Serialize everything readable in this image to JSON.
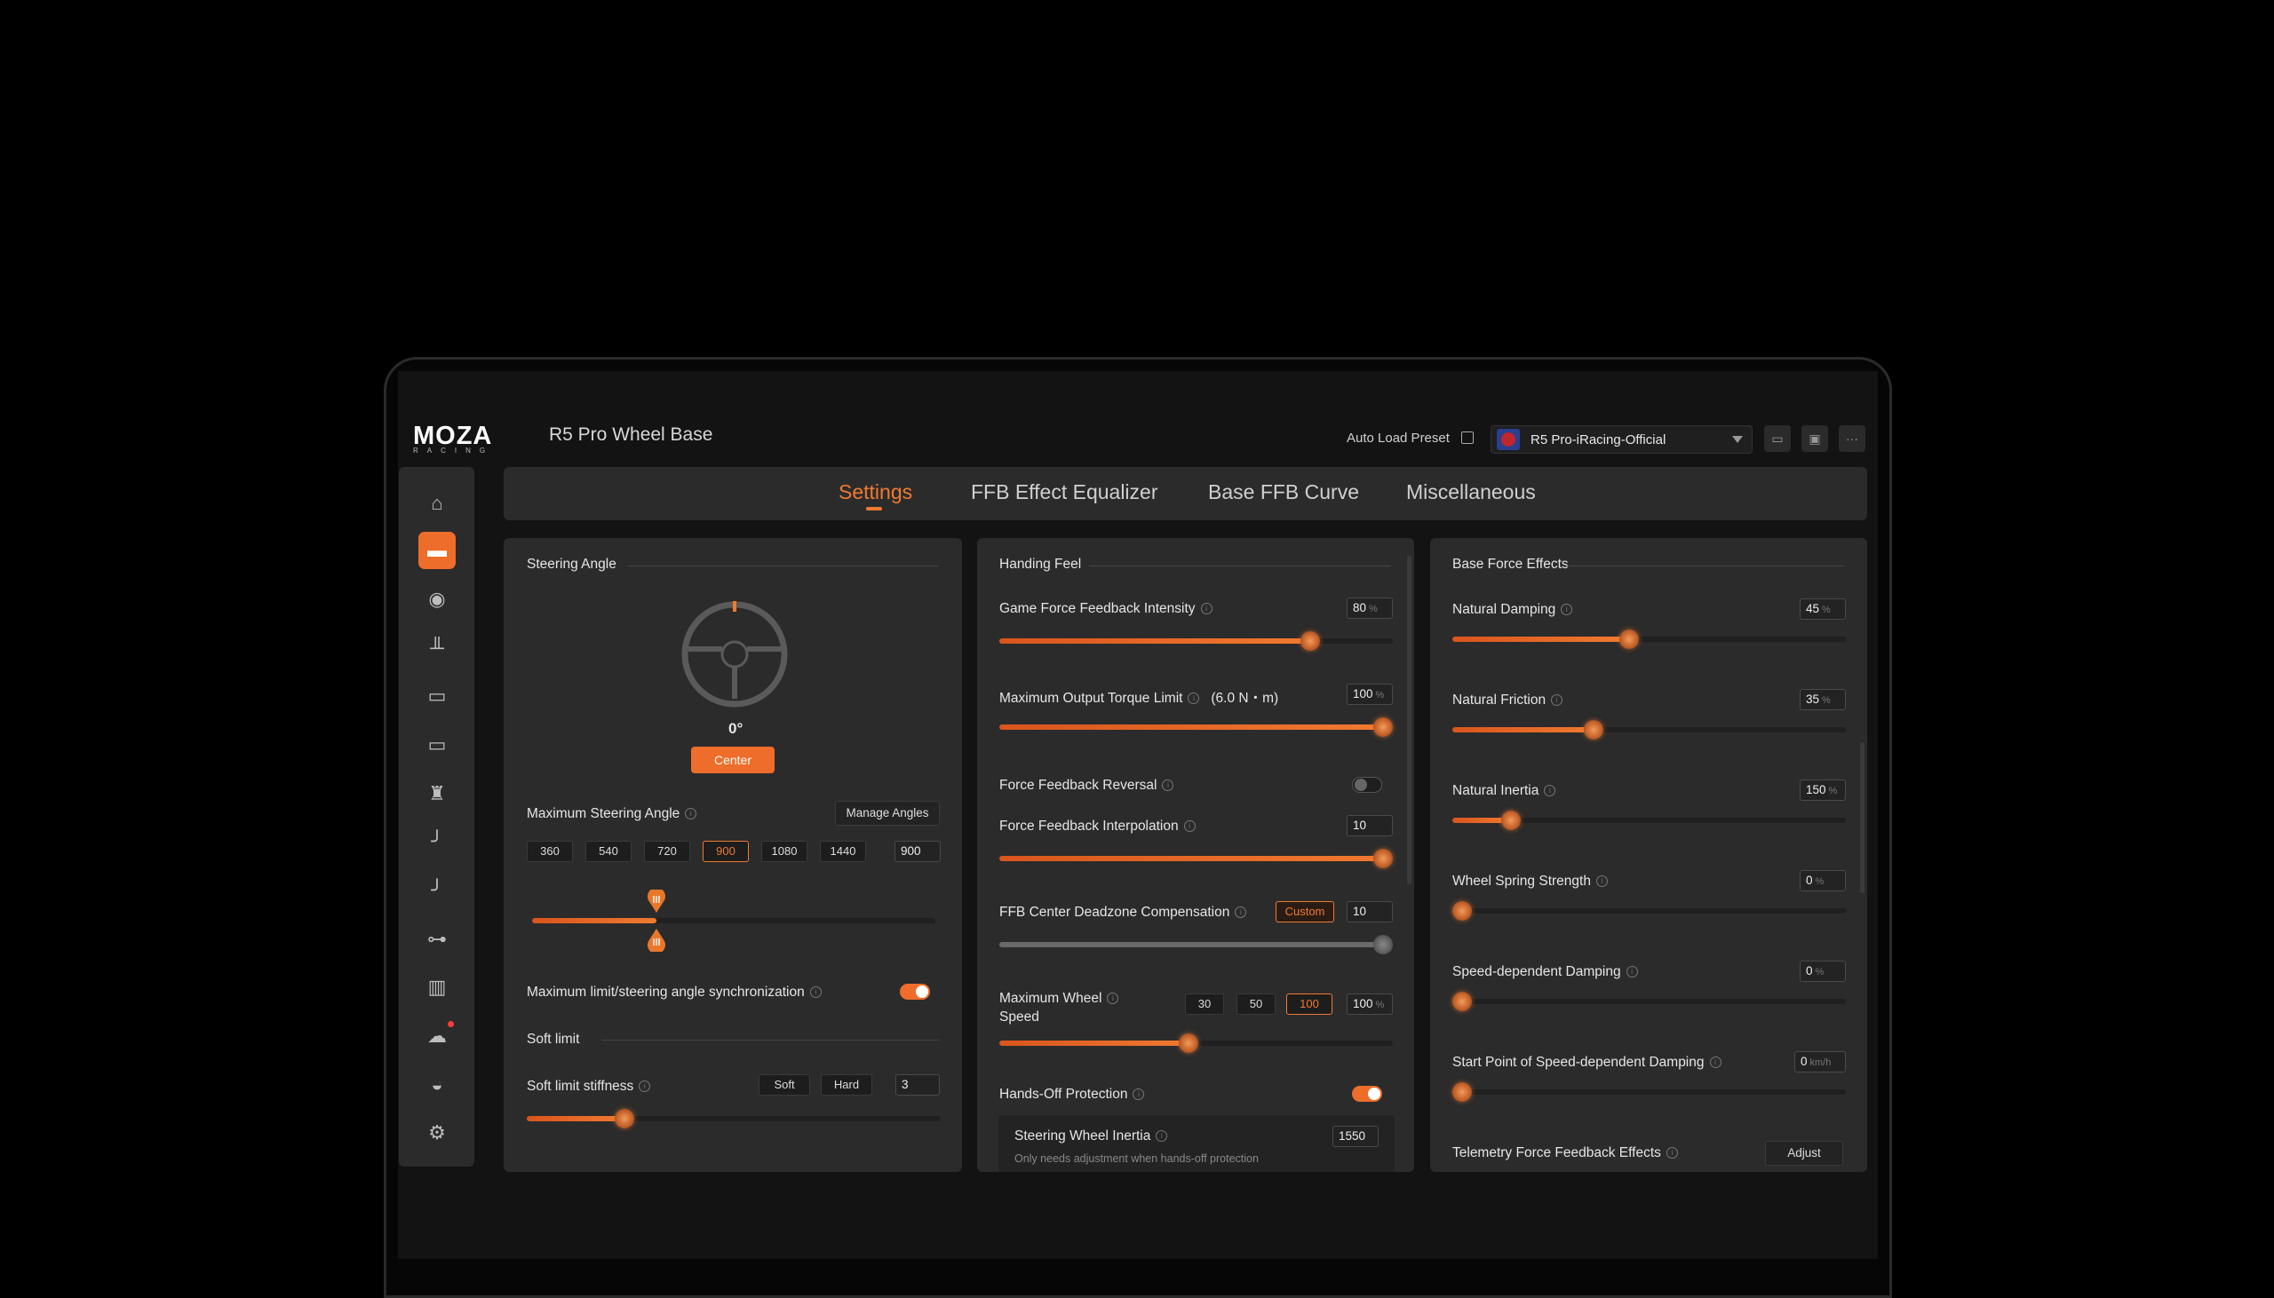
{
  "app": {
    "logo": "MOZA",
    "logo_sub": "RACING",
    "title": "R5 Pro Wheel Base"
  },
  "topbar": {
    "auto_load_label": "Auto Load Preset",
    "preset_name": "R5 Pro-iRacing-Official",
    "more_glyph": "···"
  },
  "tabs": [
    {
      "label": "Settings"
    },
    {
      "label": "FFB Effect Equalizer"
    },
    {
      "label": "Base FFB Curve"
    },
    {
      "label": "Miscellaneous"
    }
  ],
  "sidebar_icons": [
    "home-icon",
    "wheel-base-icon",
    "steering-wheel-icon",
    "pedals-icon",
    "dashboard-icon",
    "handbrake-bar-icon",
    "shifter-icon",
    "handbrake-icon",
    "sequential-shifter-icon",
    "hub-icon",
    "library-icon",
    "cloud-icon",
    "helmet-icon",
    "gear-icon"
  ],
  "steering": {
    "section": "Steering Angle",
    "angle_value": "0°",
    "center_label": "Center",
    "max_label": "Maximum Steering Angle",
    "manage_label": "Manage Angles",
    "presets": [
      "360",
      "540",
      "720",
      "900",
      "1080",
      "1440"
    ],
    "selected_preset": "900",
    "custom_value": "900",
    "sync_label": "Maximum limit/steering angle synchronization",
    "soft_section": "Soft limit",
    "stiffness_label": "Soft limit stiffness",
    "soft_btn": "Soft",
    "hard_btn": "Hard",
    "stiffness_value": "3"
  },
  "handling": {
    "section": "Handing Feel",
    "ffb_intensity": {
      "label": "Game Force Feedback Intensity",
      "value": "80",
      "unit": "%",
      "level": 0.79
    },
    "torque": {
      "label": "Maximum Output Torque Limit",
      "extra": "(6.0 N・m)",
      "value": "100",
      "unit": "%",
      "level": 1.0
    },
    "reversal_label": "Force Feedback Reversal",
    "interpolation": {
      "label": "Force Feedback Interpolation",
      "value": "10",
      "level": 1.0
    },
    "deadzone": {
      "label": "FFB Center Deadzone Compensation",
      "mode": "Custom",
      "value": "10",
      "level": 1.0
    },
    "wheel_speed": {
      "label_line1": "Maximum Wheel",
      "label_line2": "Speed",
      "presets": [
        "30",
        "50",
        "100"
      ],
      "selected": "100",
      "value": "100",
      "unit": "%",
      "level": 0.48
    },
    "hands_off_label": "Hands-Off Protection",
    "inertia": {
      "label": "Steering Wheel Inertia",
      "value": "1550",
      "note": "Only needs adjustment when hands-off protection"
    }
  },
  "base_effects": {
    "section": "Base Force Effects",
    "rows": [
      {
        "label": "Natural Damping",
        "value": "45",
        "unit": "%",
        "level": 0.45
      },
      {
        "label": "Natural Friction",
        "value": "35",
        "unit": "%",
        "level": 0.36
      },
      {
        "label": "Natural Inertia",
        "value": "150",
        "unit": "%",
        "level": 0.15
      },
      {
        "label": "Wheel Spring Strength",
        "value": "0",
        "unit": "%",
        "level": 0.0
      },
      {
        "label": "Speed-dependent Damping",
        "value": "0",
        "unit": "%",
        "level": 0.0
      },
      {
        "label": "Start Point of Speed-dependent Damping",
        "value": "0",
        "unit": "km/h",
        "level": 0.0
      }
    ],
    "telemetry_label": "Telemetry Force Feedback Effects",
    "adjust_label": "Adjust"
  }
}
